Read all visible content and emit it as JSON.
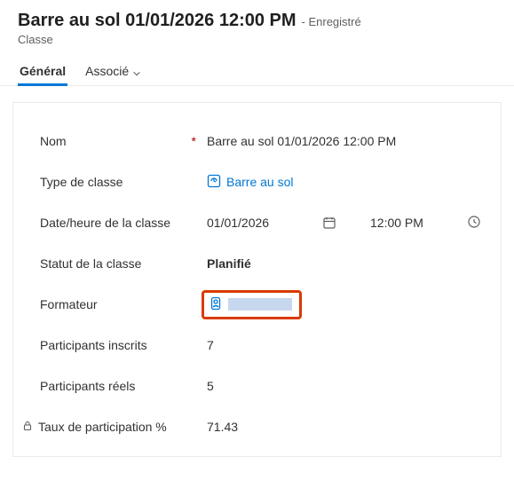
{
  "header": {
    "title": "Barre au sol 01/01/2026 12:00 PM",
    "saved_suffix": "- Enregistré",
    "entity": "Classe"
  },
  "tabs": {
    "general": "Général",
    "related": "Associé"
  },
  "fields": {
    "name": {
      "label": "Nom",
      "value": "Barre au sol 01/01/2026 12:00 PM"
    },
    "class_type": {
      "label": "Type de classe",
      "value": "Barre au sol"
    },
    "class_datetime": {
      "label": "Date/heure de la classe",
      "date": "01/01/2026",
      "time": "12:00 PM"
    },
    "status": {
      "label": "Statut de la classe",
      "value": "Planifié"
    },
    "trainer": {
      "label": "Formateur"
    },
    "registered": {
      "label": "Participants inscrits",
      "value": "7"
    },
    "actual": {
      "label": "Participants réels",
      "value": "5"
    },
    "participation_pct": {
      "label": "Taux de participation %",
      "value": "71.43"
    }
  }
}
